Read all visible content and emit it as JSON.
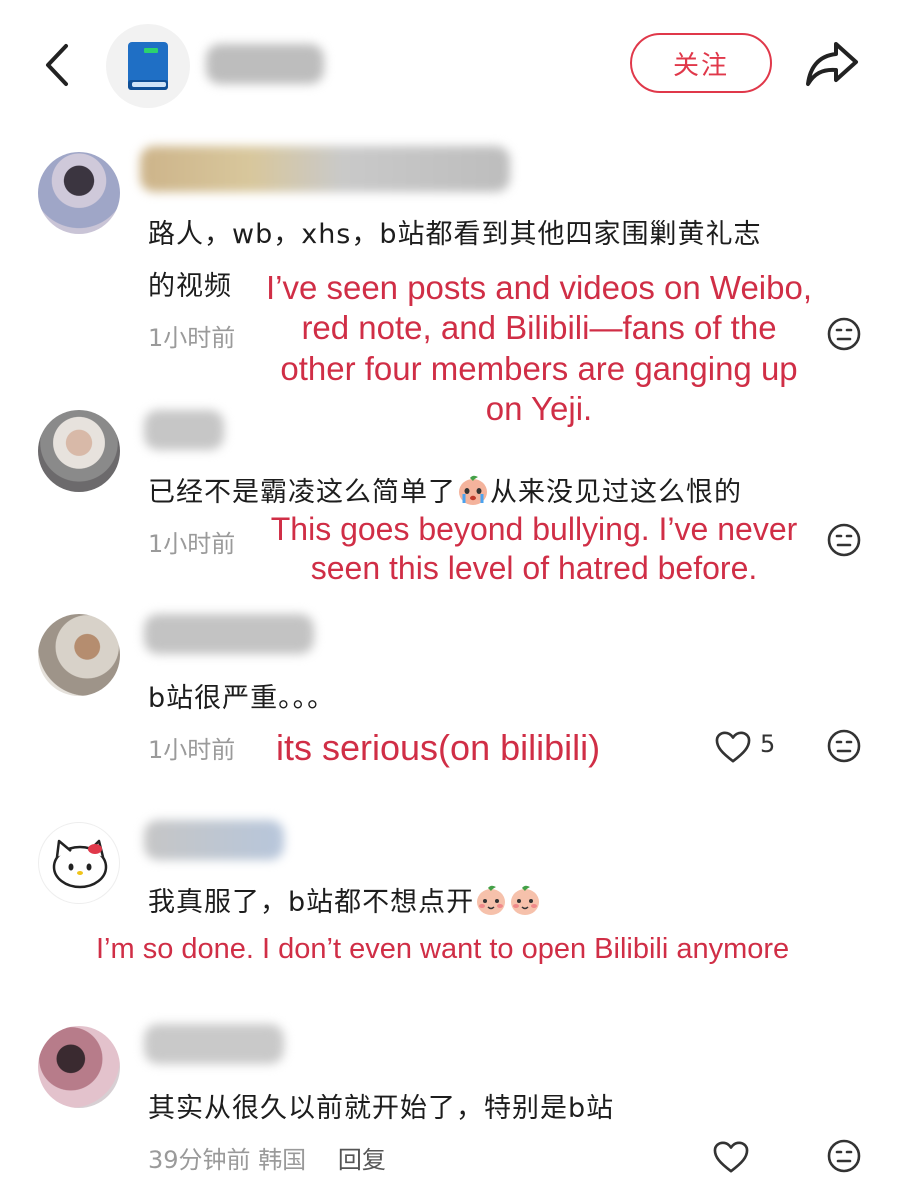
{
  "header": {
    "follow_label": "关注"
  },
  "comments": [
    {
      "text_line1": "路人，wb，xhs，b站都看到其他四家围剿黄礼志",
      "text_line2": "的视频",
      "time": "1小时前",
      "translation": "I’ve seen posts and videos on Weibo,\nred note, and Bilibili—fans of the\nother four members are ganging up\non Yeji."
    },
    {
      "text": "已经不是霸凌这么简单了",
      "text_after": "从来没见过这么恨的",
      "time": "1小时前",
      "translation": "This goes beyond bullying. I’ve never\nseen this level of hatred before."
    },
    {
      "text": "b站很严重。。。",
      "time": "1小时前",
      "likes": "5",
      "translation": "its serious(on bilibili)"
    },
    {
      "text": "我真服了，b站都不想点开",
      "translation": "I’m so done. I don’t even want to open Bilibili anymore"
    },
    {
      "text": "其实从很久以前就开始了，特别是b站",
      "time": "39分钟前",
      "location": "韩国",
      "reply_label": "回复"
    }
  ],
  "icons": {
    "back": "chevron-left-icon",
    "share": "share-arrow-icon",
    "like": "heart-icon",
    "react": "neutral-face-icon"
  },
  "colors": {
    "accent": "#e0384a",
    "translation": "#d02e46"
  }
}
